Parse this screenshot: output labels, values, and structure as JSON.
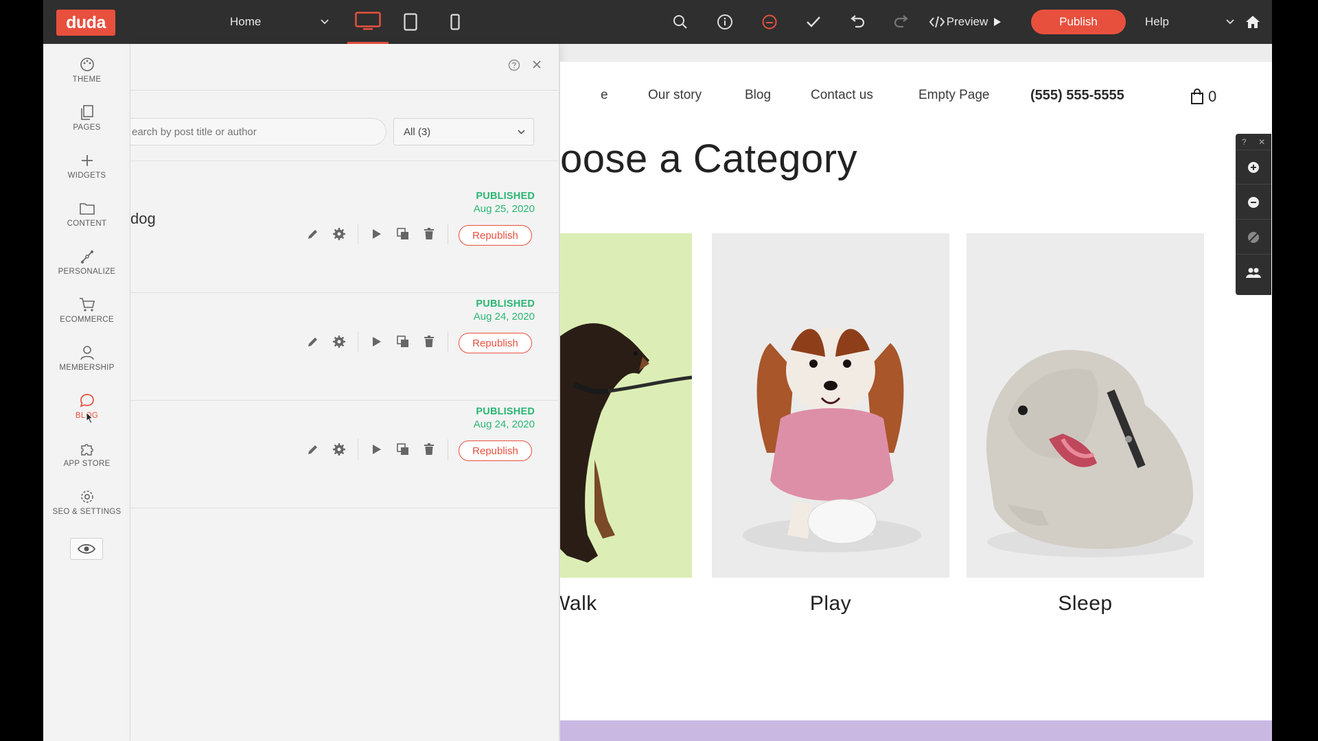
{
  "topbar": {
    "logo": "duda",
    "page_select": "Home",
    "preview_label": "Preview",
    "publish_label": "Publish",
    "help_label": "Help"
  },
  "sidebar": {
    "items": [
      {
        "label": "THEME",
        "icon": "palette-icon"
      },
      {
        "label": "PAGES",
        "icon": "pages-icon"
      },
      {
        "label": "WIDGETS",
        "icon": "plus-icon"
      },
      {
        "label": "CONTENT",
        "icon": "folder-icon"
      },
      {
        "label": "PERSONALIZE",
        "icon": "personalize-icon"
      },
      {
        "label": "ECOMMERCE",
        "icon": "cart-icon"
      },
      {
        "label": "MEMBERSHIP",
        "icon": "person-icon"
      },
      {
        "label": "BLOG",
        "icon": "chat-bubble-icon"
      },
      {
        "label": "APP STORE",
        "icon": "puzzle-icon"
      },
      {
        "label": "SEO & SETTINGS",
        "icon": "gear-icon"
      }
    ]
  },
  "blog_panel": {
    "search_placeholder": "earch by post title or author",
    "filter_value": "All (3)",
    "posts": [
      {
        "title": "dog",
        "status": "PUBLISHED",
        "date": "Aug 25, 2020",
        "action": "Republish"
      },
      {
        "title": "",
        "status": "PUBLISHED",
        "date": "Aug 24, 2020",
        "action": "Republish"
      },
      {
        "title": "",
        "status": "PUBLISHED",
        "date": "Aug 24, 2020",
        "action": "Republish"
      }
    ]
  },
  "site": {
    "nav": [
      "e",
      "Our story",
      "Blog",
      "Contact us",
      "Empty Page"
    ],
    "phone": "(555) 555-5555",
    "cart_count": "0",
    "heading": "oose a Category",
    "categories": [
      "Walk",
      "Play",
      "Sleep"
    ]
  },
  "colors": {
    "accent": "#e8503e",
    "published": "#2bb673",
    "topbar": "#2f2f2f"
  }
}
